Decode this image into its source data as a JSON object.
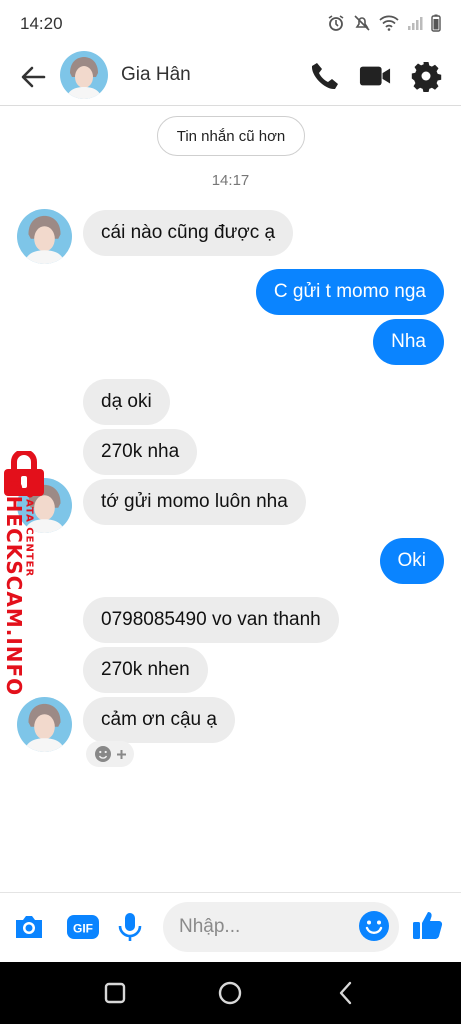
{
  "status_bar": {
    "time": "14:20"
  },
  "header": {
    "contact_name": "Gia Hân"
  },
  "conversation": {
    "older_messages_label": "Tin nhắn cũ hơn",
    "timestamp": "14:17",
    "messages": [
      {
        "side": "in",
        "text": "cái nào cũng được ạ"
      },
      {
        "side": "out",
        "text": "C gửi t momo nga"
      },
      {
        "side": "out",
        "text": "Nha"
      },
      {
        "side": "in",
        "text": "dạ oki"
      },
      {
        "side": "in",
        "text": "270k nha"
      },
      {
        "side": "in",
        "text": "tớ gửi momo luôn nha"
      },
      {
        "side": "out",
        "text": "Oki"
      },
      {
        "side": "in",
        "text": "0798085490 vo van thanh"
      },
      {
        "side": "in",
        "text": "270k nhen"
      },
      {
        "side": "in",
        "text": "cảm ơn cậu ạ"
      }
    ]
  },
  "watermark": {
    "site": "CHECKSCAM.INFO",
    "tagline": "DATA CENTER"
  },
  "composer": {
    "placeholder": "Nhập...",
    "gif_label": "GIF"
  },
  "colors": {
    "accent": "#0a84ff",
    "incoming_bubble": "#ececec",
    "watermark": "#e3101b"
  }
}
